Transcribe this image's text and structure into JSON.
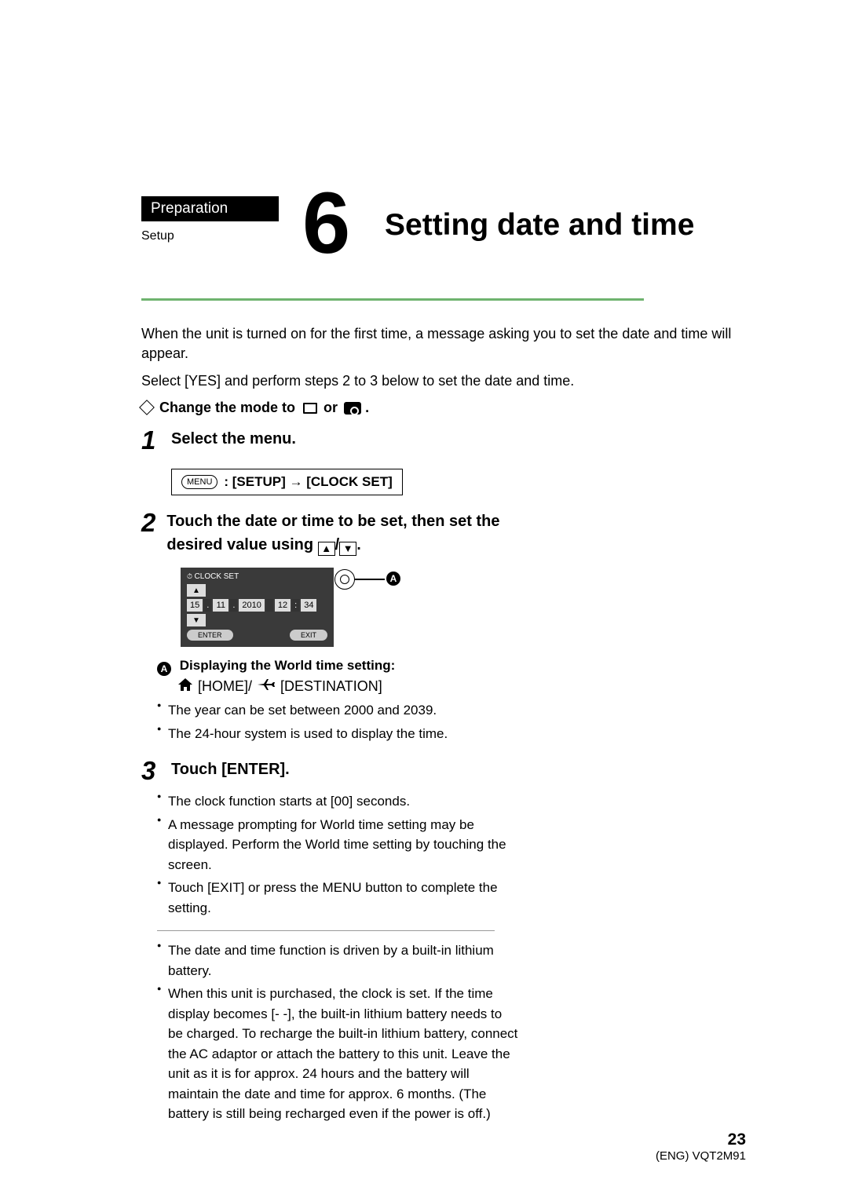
{
  "header": {
    "category": "Preparation",
    "subcategory": "Setup",
    "section_number": "6",
    "title": "Setting date and time"
  },
  "intro": {
    "p1": "When the unit is turned on for the first time, a message asking you to set the date and time will appear.",
    "p2": "Select [YES] and perform steps 2 to 3 below to set the date and time."
  },
  "mode_line": {
    "prefix": "Change the mode to",
    "or": "or",
    "suffix": "."
  },
  "steps": {
    "s1": {
      "num": "1",
      "text": "Select the menu."
    },
    "menu_path": {
      "menu_label": "MENU",
      "path": ": [SETUP] → [CLOCK SET]"
    },
    "s2": {
      "num": "2",
      "text": "Touch the date or time to be set, then set the desired value using",
      "suffix": "."
    },
    "s3": {
      "num": "3",
      "text": "Touch [ENTER]."
    }
  },
  "clock_figure": {
    "title": "CLOCK SET",
    "cells": {
      "d": "15",
      "m": "11",
      "y": "2010",
      "h": "12",
      "min": "34",
      "sep": "."
    },
    "enter": "ENTER",
    "exit": "EXIT",
    "callout": "A"
  },
  "world_time": {
    "label": "A",
    "heading": "Displaying the World time setting:",
    "home": "[HOME]/",
    "dest": "[DESTINATION]"
  },
  "bullets_a": [
    "The year can be set between 2000 and 2039.",
    "The 24-hour system is used to display the time."
  ],
  "bullets_b": [
    "The clock function starts at [00] seconds.",
    "A message prompting for World time setting may be displayed. Perform the World time setting by touching the screen.",
    "Touch [EXIT] or press the MENU button to complete the setting."
  ],
  "bullets_c": [
    "The date and time function is driven by a built-in lithium battery.",
    "When this unit is purchased, the clock is set. If the time display becomes [- -], the built-in lithium battery needs to be charged. To recharge the built-in lithium battery, connect the AC adaptor or attach the battery to this unit. Leave the unit as it is for approx. 24 hours and the battery will maintain the date and time for approx. 6 months. (The battery is still being recharged even if the power is off.)"
  ],
  "footer": {
    "page": "23",
    "docid": "(ENG) VQT2M91"
  }
}
